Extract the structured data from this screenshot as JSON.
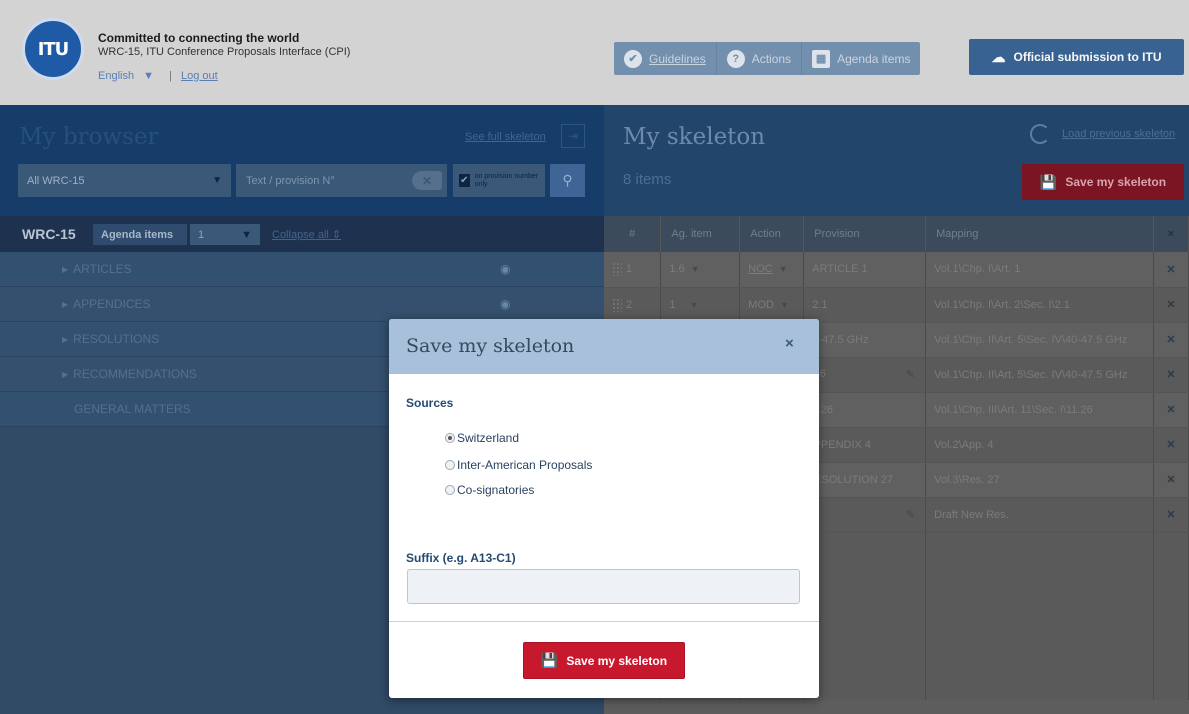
{
  "header": {
    "logo_text": "ITU",
    "title": "Committed to connecting the world",
    "subtitle": "WRC-15, ITU Conference Proposals Interface (CPI)",
    "language": "English",
    "logout": "Log out",
    "nav": [
      {
        "label": "Guidelines",
        "icon": "check-circle-icon"
      },
      {
        "label": "Actions",
        "icon": "question-circle-icon"
      },
      {
        "label": "Agenda items",
        "icon": "calendar-icon"
      }
    ],
    "submit_label": "Official submission to ITU"
  },
  "browser": {
    "title": "My browser",
    "see_full_skeleton": "See full skeleton",
    "scope_select": "All WRC-15",
    "search_placeholder": "Text / provision N°",
    "only_provision_label": "on provision number only",
    "wrc_label": "WRC-15",
    "agenda_items_label": "Agenda items",
    "agenda_items_value": "1",
    "collapse_all": "Collapse all",
    "tree": [
      {
        "label": "ARTICLES",
        "has_arrow": true,
        "has_eye": true
      },
      {
        "label": "APPENDICES",
        "has_arrow": true,
        "has_eye": true
      },
      {
        "label": "RESOLUTIONS",
        "has_arrow": true,
        "has_eye": false
      },
      {
        "label": "RECOMMENDATIONS",
        "has_arrow": true,
        "has_eye": false
      },
      {
        "label": "GENERAL MATTERS",
        "has_arrow": false,
        "has_eye": false
      }
    ]
  },
  "skeleton": {
    "title": "My skeleton",
    "items_count": "8 items",
    "load_previous": "Load previous skeleton",
    "save_label": "Save my skeleton",
    "columns": [
      "#",
      "Ag. item",
      "Action",
      "Provision",
      "Mapping",
      "×"
    ],
    "rows": [
      {
        "num": "1",
        "ag_item": "1.6",
        "action": "NOC",
        "provision": "ARTICLE 1",
        "mapping": "Vol.1\\Chp. I\\Art. 1"
      },
      {
        "num": "2",
        "ag_item": "1",
        "action": "MOD",
        "provision": "2.1",
        "mapping": "Vol.1\\Chp. I\\Art. 2\\Sec. I\\2.1"
      },
      {
        "num": "",
        "ag_item": "",
        "action": "",
        "provision": "40-47.5 GHz",
        "mapping": "Vol.1\\Chp. II\\Art. 5\\Sec. IV\\40-47.5 GHz"
      },
      {
        "num": "",
        "ag_item": "",
        "action": "",
        "provision": "A16",
        "mapping": "Vol.1\\Chp. II\\Art. 5\\Sec. IV\\40-47.5 GHz"
      },
      {
        "num": "",
        "ag_item": "",
        "action": "",
        "provision": "11.26",
        "mapping": "Vol.1\\Chp. III\\Art. 11\\Sec. I\\11.26"
      },
      {
        "num": "",
        "ag_item": "",
        "action": "",
        "provision": "APPENDIX 4",
        "mapping": "Vol.2\\App. 4"
      },
      {
        "num": "",
        "ag_item": "",
        "action": "",
        "provision": "RESOLUTION 27",
        "mapping": "Vol.3\\Res. 27"
      },
      {
        "num": "",
        "ag_item": "",
        "action": "",
        "provision": "",
        "mapping": "Draft New Res."
      }
    ]
  },
  "modal": {
    "title": "Save my skeleton",
    "close": "×",
    "sources_label": "Sources",
    "sources": [
      "Switzerland",
      "Inter-American Proposals",
      "Co-signatories"
    ],
    "selected_source": "Switzerland",
    "suffix_label": "Suffix (e.g. A13-C1)",
    "suffix_value": "",
    "save_label": "Save my skeleton"
  },
  "colors": {
    "primary_blue": "#1e4f86",
    "save_red": "#c8182e",
    "modal_header": "#a8c0d9"
  }
}
